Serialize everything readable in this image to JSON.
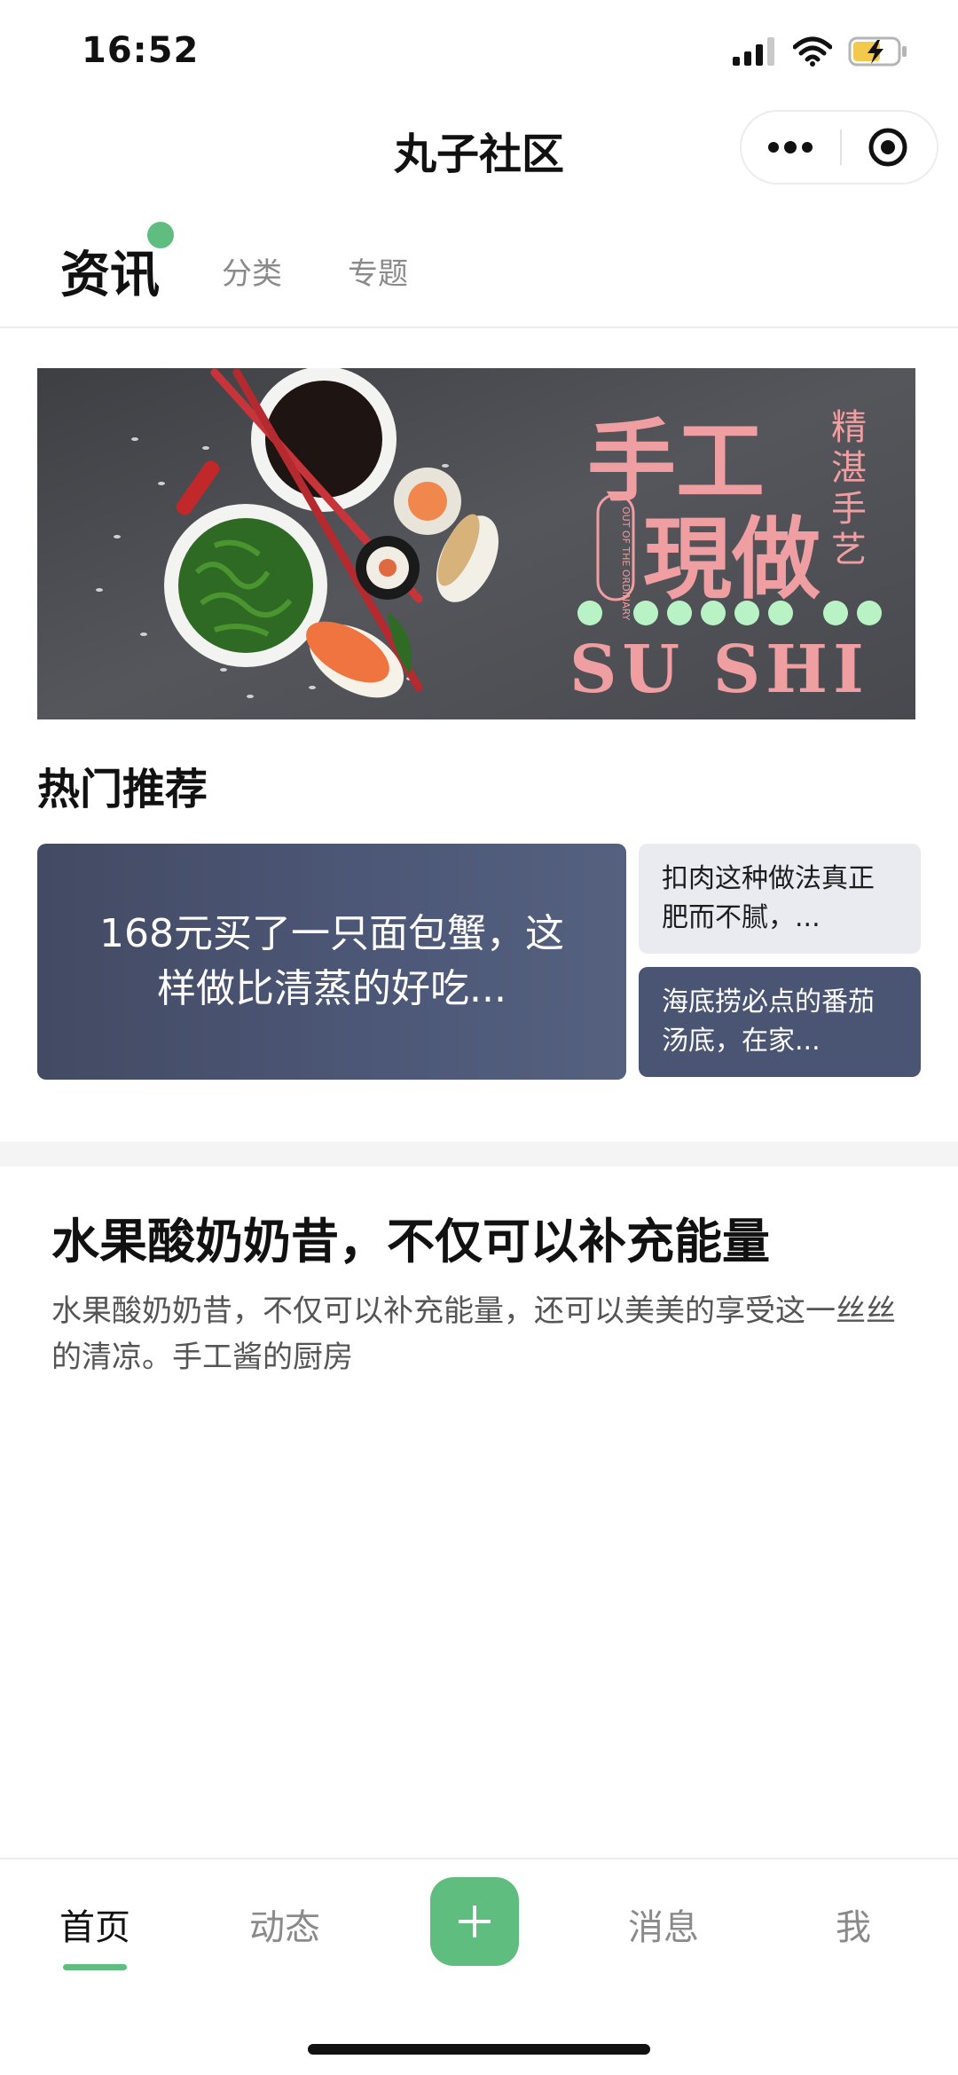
{
  "status_bar": {
    "time": "16:52",
    "icons": [
      "signal-icon",
      "wifi-icon",
      "battery-charging-icon"
    ]
  },
  "nav": {
    "title": "丸子社区",
    "capsule_icons": [
      "more-dots-icon",
      "close-target-icon"
    ]
  },
  "tabs": [
    {
      "label": "资讯",
      "active": true,
      "has_dot": true
    },
    {
      "label": "分类",
      "active": false
    },
    {
      "label": "专题",
      "active": false
    }
  ],
  "banner": {
    "headline": [
      "手工",
      "現做"
    ],
    "side_text": [
      "精",
      "湛",
      "手",
      "艺"
    ],
    "seal_text": "OUT OF THE ORDINARY",
    "brand": "SU SHI",
    "accent_color": "#ef9ea1",
    "dot_color": "#b9f3c5"
  },
  "hot": {
    "title": "热门推荐",
    "big_card": {
      "text": "168元买了一只面包蟹，这样做比清蒸的好吃..."
    },
    "small_cards": [
      {
        "text": "扣肉这种做法真正肥而不腻，..."
      },
      {
        "text": "海底捞必点的番茄汤底，在家..."
      }
    ]
  },
  "article": {
    "title": "水果酸奶奶昔，不仅可以补充能量",
    "description": "水果酸奶奶昔，不仅可以补充能量，还可以美美的享受这一丝丝的清凉。手工酱的厨房"
  },
  "tabbar": {
    "items": [
      {
        "label": "首页",
        "active": true
      },
      {
        "label": "动态",
        "active": false
      },
      {
        "label": "消息",
        "active": false
      },
      {
        "label": "我",
        "active": false
      }
    ],
    "add_icon": "plus-icon",
    "accent_color": "#5fbe7f"
  }
}
